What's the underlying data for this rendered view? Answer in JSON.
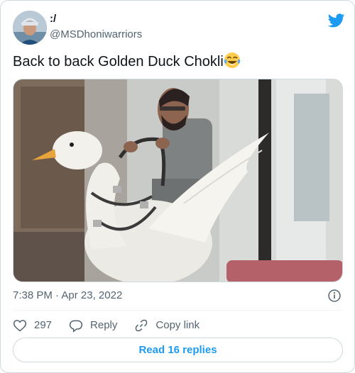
{
  "user": {
    "display_name": ":/",
    "handle": "@MSDhoniwarriors"
  },
  "tweet": {
    "text": "Back to back Golden Duck Chokli",
    "emoji": "face-with-tears-of-joy"
  },
  "meta": {
    "time": "7:38 PM",
    "separator": "·",
    "date": "Apr 23, 2022"
  },
  "actions": {
    "like_count": "297",
    "reply_label": "Reply",
    "copy_label": "Copy link"
  },
  "read_replies_label": "Read 16 replies",
  "colors": {
    "brand": "#1d9bf0",
    "text_primary": "#0f1419",
    "text_secondary": "#536471",
    "border": "#cfd9de"
  }
}
